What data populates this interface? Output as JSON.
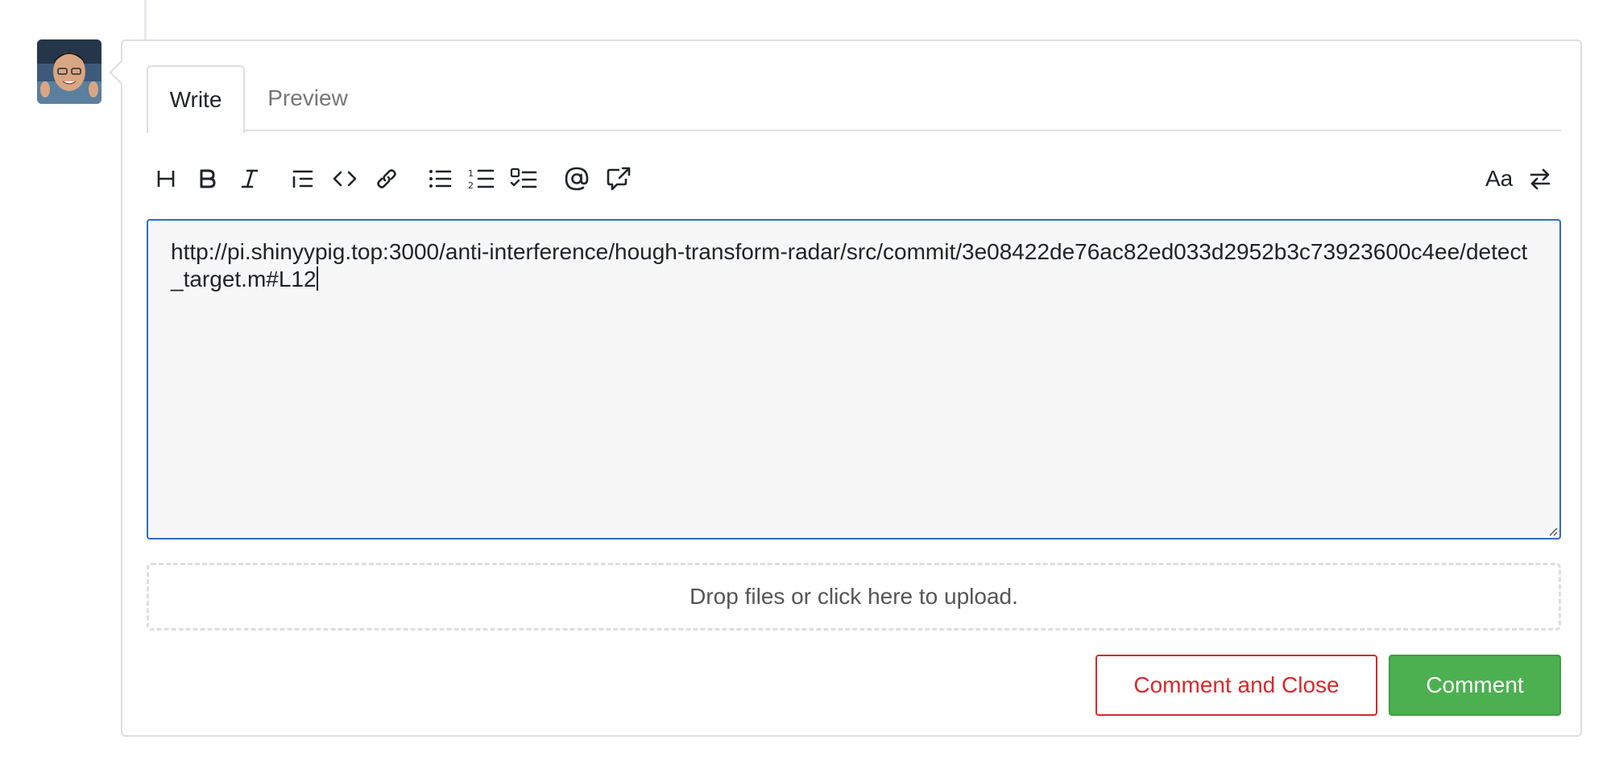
{
  "tabs": {
    "write_label": "Write",
    "preview_label": "Preview",
    "active": "Write"
  },
  "toolbar": {
    "left_icons": [
      "heading-icon",
      "bold-icon",
      "italic-icon",
      "quote-icon",
      "code-icon",
      "link-icon",
      "bullet-list-icon",
      "numbered-list-icon",
      "task-list-icon",
      "mention-icon",
      "cross-reference-icon"
    ],
    "right_icons": [
      "text-style-icon",
      "switch-editor-icon"
    ]
  },
  "editor": {
    "value": "http://pi.shinyypig.top:3000/anti-interference/hough-transform-radar/src/commit/3e08422de76ac82ed033d2952b3c73923600c4ee/detect_target.m#L12"
  },
  "upload": {
    "label": "Drop files or click here to upload."
  },
  "actions": {
    "close_label": "Comment and Close",
    "comment_label": "Comment"
  },
  "colors": {
    "primary_blue": "#2f6dc4",
    "danger_red": "#db2828",
    "success_green": "#4cb050",
    "border_gray": "#dedede"
  }
}
